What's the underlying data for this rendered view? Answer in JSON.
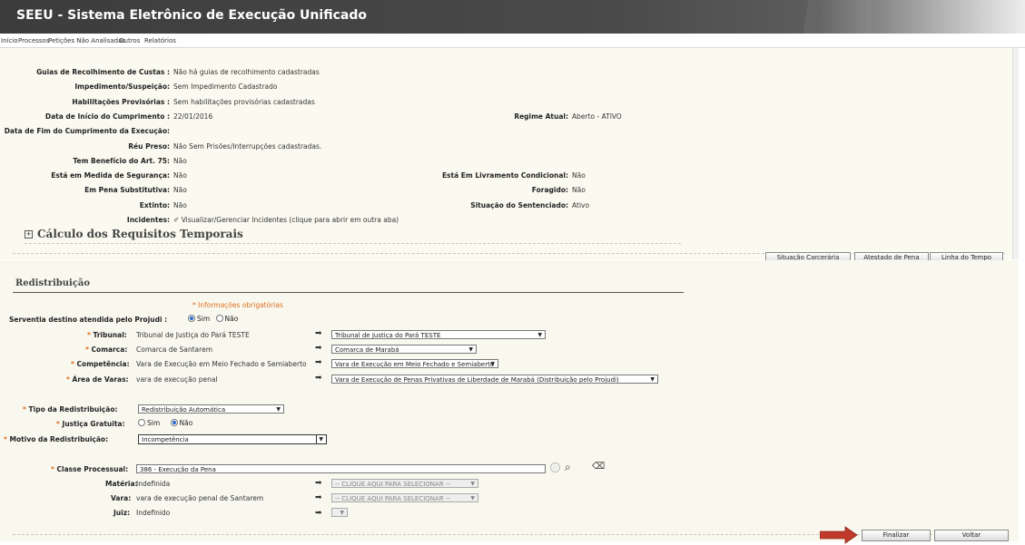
{
  "app": {
    "title": "SEEU - Sistema Eletrônico de Execução Unificado"
  },
  "menu": [
    "Início",
    "Processos",
    "Petições Não Analisadas",
    "Outros",
    "Relatórios"
  ],
  "info": [
    {
      "label": "Guias de Recolhimento de Custas :",
      "value": "Não há guias de recolhimento cadastradas"
    },
    {
      "label": "Impedimento/Suspeição:",
      "value": "Sem Impedimento Cadastrado"
    },
    {
      "label": "Habilitações Provisórias :",
      "value": "Sem habilitações provisórias cadastradas"
    },
    {
      "label": "Data de Início do Cumprimento :",
      "value": "22/01/2016"
    },
    {
      "label": "Data de Fim do Cumprimento da Execução:",
      "value": ""
    },
    {
      "label": "Réu Preso:",
      "value": "Não Sem Prisões/Interrupções cadastradas."
    },
    {
      "label": "Tem Benefício do Art. 75:",
      "value": "Não"
    },
    {
      "label": "Está em Medida de Segurança:",
      "value": "Não"
    },
    {
      "label": "Em Pena Substitutiva:",
      "value": "Não"
    },
    {
      "label": "Extinto:",
      "value": "Não"
    },
    {
      "label": "Incidentes:",
      "value": "Visualizar/Gerenciar Incidentes (clique para abrir em outra aba)"
    }
  ],
  "info_right": [
    {
      "label": "Regime Atual:",
      "value": "Aberto - ATIVO"
    },
    {
      "label": "Está Em Livramento Condicional:",
      "value": "Não"
    },
    {
      "label": "Foragido:",
      "value": "Não"
    },
    {
      "label": "Situação do Sentenciado:",
      "value": "Ativo"
    }
  ],
  "calc_title": "Cálculo dos Requisitos Temporais",
  "action_buttons": [
    "Situação Carcerária",
    "Atestado de Pena",
    "Linha do Tempo"
  ],
  "redis": {
    "title": "Redistribuição",
    "required_note": "* Informações obrigatórias",
    "serventia_label": "Serventia destino atendida pelo Projudi :",
    "sim": "Sim",
    "nao": "Não",
    "rows": [
      {
        "label": "Tribunal:",
        "current": "Tribunal de Justiça do Pará TESTE",
        "target": "Tribunal de Justiça do Pará TESTE"
      },
      {
        "label": "Comarca:",
        "current": "Comarca de Santarem",
        "target": "Comarca de Marabá"
      },
      {
        "label": "Competência:",
        "current": "Vara de Execução em Meio Fechado e Semiaberto",
        "target": "Vara de Execução em Meio Fechado e Semiaberto"
      },
      {
        "label": "Área de Varas:",
        "current": "vara de execução penal",
        "target": "Vara de Execução de Penas Privativas de Liberdade de Marabá (Distribuição pelo Projudi)"
      }
    ],
    "tipo_label": "Tipo da Redistribuição:",
    "tipo_value": "Redistribuição Automática",
    "justica_label": "Justiça Gratuita:",
    "motivo_label": "Motivo da Redistribuição:",
    "motivo_value": "Incompetência",
    "classe_label": "Classe Processual:",
    "classe_value": "386 - Execução da Pena",
    "materia_label": "Matéria:",
    "materia_value": "Indefinida",
    "vara_label": "Vara:",
    "vara_value": "vara de execução penal de Santarem",
    "juiz_label": "Juiz:",
    "juiz_value": "Indefinido",
    "clique": "-- CLIQUE AQUI PARA SELECIONAR --"
  },
  "footer": {
    "finalizar": "Finalizar",
    "voltar": "Voltar"
  },
  "colors": {
    "header": "#3c3c3c",
    "panel": "#fbfaf0",
    "required": "#e07020",
    "arrow": "#c0392b"
  }
}
